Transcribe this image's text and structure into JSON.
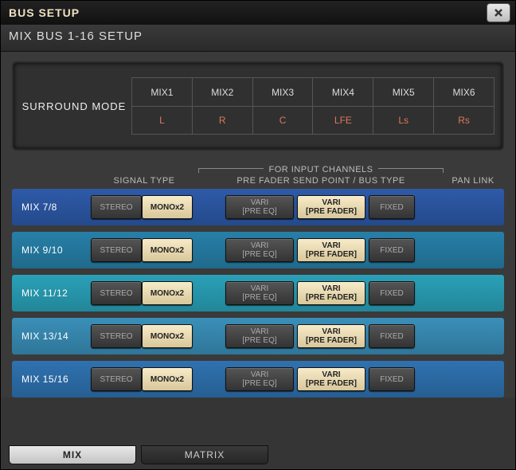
{
  "window": {
    "title": "BUS SETUP",
    "subtitle": "MIX BUS 1-16 SETUP"
  },
  "surround": {
    "label": "SURROUND MODE",
    "mixes": [
      "MIX1",
      "MIX2",
      "MIX3",
      "MIX4",
      "MIX5",
      "MIX6"
    ],
    "channels": [
      "L",
      "R",
      "C",
      "LFE",
      "Ls",
      "Rs"
    ]
  },
  "headers": {
    "signal_type": "SIGNAL TYPE",
    "for_input": "FOR INPUT CHANNELS",
    "send_point": "PRE FADER SEND POINT / BUS TYPE",
    "pan_link": "PAN LINK"
  },
  "buttons": {
    "stereo": "STEREO",
    "mono": "MONOx2",
    "vari_eq_l1": "VARI",
    "vari_eq_l2": "[PRE EQ]",
    "vari_fader_l1": "VARI",
    "vari_fader_l2": "[PRE FADER]",
    "fixed": "FIXED"
  },
  "rows": [
    {
      "label": "MIX 7/8",
      "cls": "c1"
    },
    {
      "label": "MIX 9/10",
      "cls": "c2"
    },
    {
      "label": "MIX 11/12",
      "cls": "c3"
    },
    {
      "label": "MIX 13/14",
      "cls": "c4"
    },
    {
      "label": "MIX 15/16",
      "cls": "c5"
    }
  ],
  "tabs": {
    "mix": "MIX",
    "matrix": "MATRIX"
  }
}
